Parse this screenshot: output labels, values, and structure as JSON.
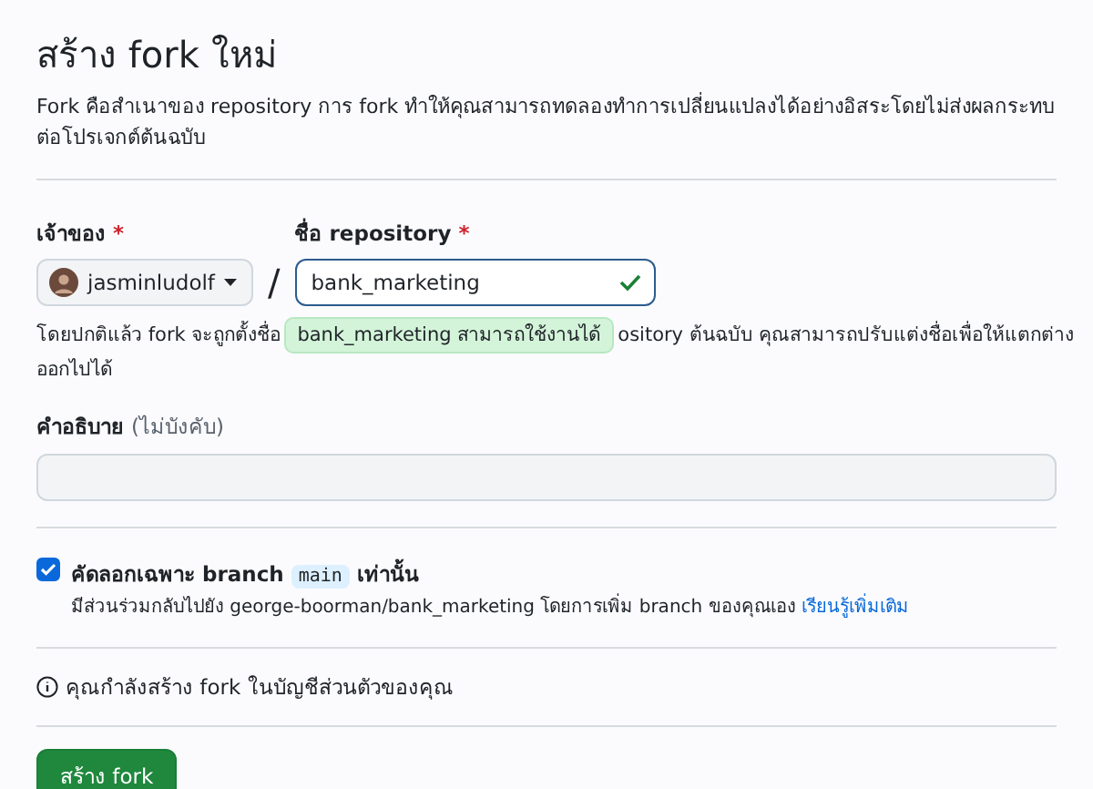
{
  "title": "สร้าง fork ใหม่",
  "intro": "Fork คือสำเนาของ repository การ fork ทำให้คุณสามารถทดลองทำการเปลี่ยนแปลงได้อย่างอิสระโดยไม่ส่งผลกระทบต่อโปรเจกต์ต้นฉบับ",
  "owner": {
    "label": "เจ้าของ",
    "required_mark": "*",
    "value": "jasminludolf"
  },
  "separator": "/",
  "repo_name": {
    "label": "ชื่อ repository",
    "required_mark": "*",
    "value": "bank_marketing",
    "valid": true,
    "tooltip": "bank_marketing สามารถใช้งานได้"
  },
  "name_hint": [
    "โดยปกติแล้ว fork จะถูกตั้งชื่อ",
    "ository ต้นฉบับ คุณสามารถปรับแต่งชื่อเพื่อให้แตกต่าง",
    "ออกไปได้"
  ],
  "description": {
    "label": "คำอธิบาย",
    "optional_note": "(ไม่บังคับ)"
  },
  "copy_branch": {
    "checked": true,
    "label_before": "คัดลอกเฉพาะ branch",
    "branch": "main",
    "label_after": "เท่านั้น",
    "note": "มีส่วนร่วมกลับไปยัง george-boorman/bank_marketing โดยการเพิ่ม branch ของคุณเอง",
    "link": "เรียนรู้เพิ่มเติม"
  },
  "info": "คุณกำลังสร้าง fork ในบัญชีส่วนตัวของคุณ",
  "submit": "สร้าง fork"
}
